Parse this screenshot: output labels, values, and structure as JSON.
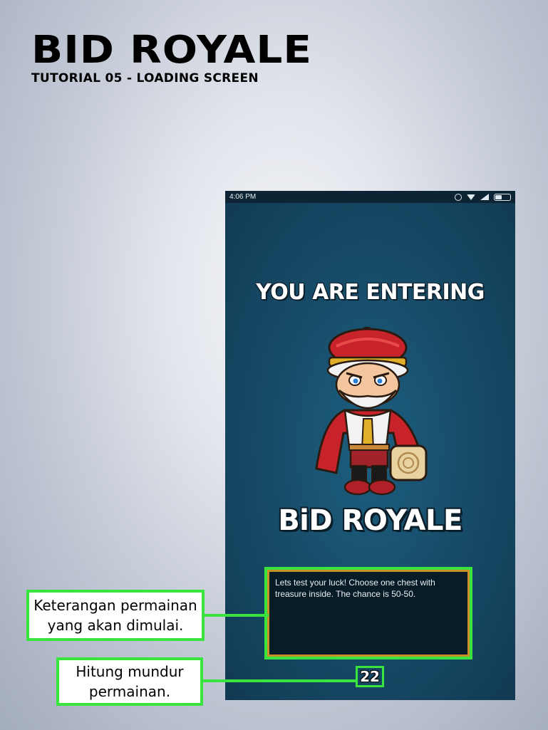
{
  "document": {
    "title": "BID ROYALE",
    "subtitle": "TUTORIAL 05 - LOADING SCREEN"
  },
  "phone": {
    "status_bar": {
      "time": "4:06 PM",
      "icons": [
        "alarm-icon",
        "wifi-icon",
        "signal-icon",
        "battery-icon"
      ]
    },
    "loading_screen": {
      "heading": "YOU ARE ENTERING",
      "game_title": "BiD ROYALE",
      "description": "Lets test your luck! Choose one chest with treasure inside. The chance is 50-50.",
      "countdown": "22"
    }
  },
  "annotations": {
    "description_callout": [
      "Keterangan permainan",
      "yang akan dimulai."
    ],
    "countdown_callout": [
      "Hitung mundur",
      "permainan."
    ]
  },
  "colors": {
    "highlight": "#39e43f",
    "panel_border": "#c9902a",
    "screen_bg": "#184f6c"
  }
}
